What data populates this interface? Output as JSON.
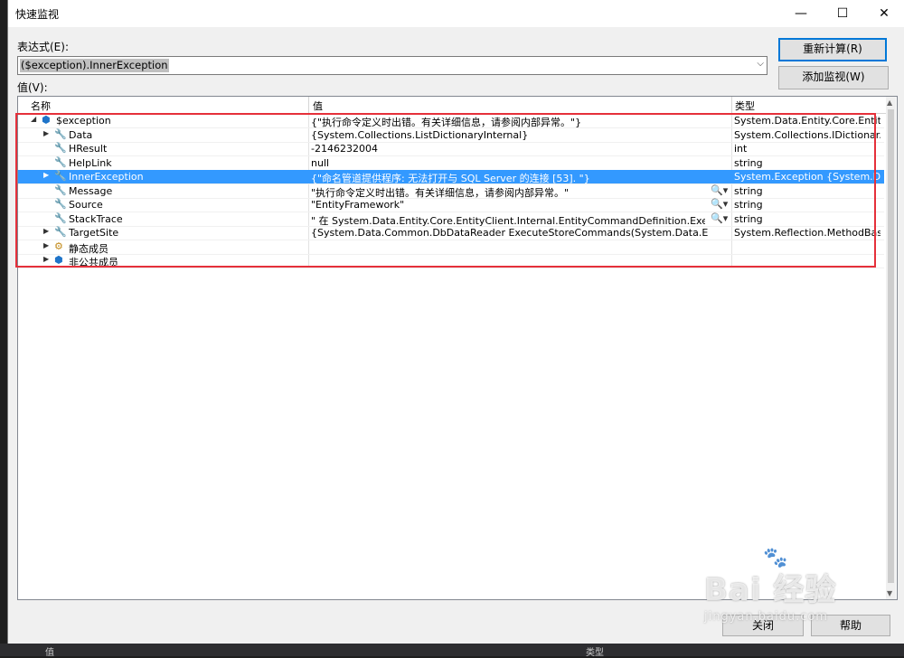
{
  "ide_background": {
    "bottom_labels": [
      "值",
      "类型"
    ]
  },
  "window": {
    "title": "快速监视",
    "controls": {
      "minimize": "—",
      "maximize": "☐",
      "close": "✕"
    }
  },
  "expression": {
    "label": "表达式(E):",
    "value": "($exception).InnerException"
  },
  "buttons": {
    "reevaluate": "重新计算(R)",
    "add_watch": "添加监视(W)",
    "close": "关闭",
    "help": "帮助"
  },
  "value_label": "值(V):",
  "grid": {
    "columns": [
      "名称",
      "值",
      "类型"
    ],
    "rows": [
      {
        "name": "$exception",
        "value": "{\"执行命令定义时出错。有关详细信息，请参阅内部异常。\"}",
        "type": "System.Data.Entity.Core.Entity...",
        "icon": "object-icon",
        "expand": "expanded",
        "indent": 0,
        "selected": false,
        "magnifier": false
      },
      {
        "name": "Data",
        "value": "{System.Collections.ListDictionaryInternal}",
        "type": "System.Collections.IDictionar...",
        "icon": "wrench-icon",
        "expand": "collapsed",
        "indent": 1,
        "selected": false,
        "magnifier": false
      },
      {
        "name": "HResult",
        "value": "-2146232004",
        "type": "int",
        "icon": "wrench-icon",
        "expand": "none",
        "indent": 1,
        "selected": false,
        "magnifier": false
      },
      {
        "name": "HelpLink",
        "value": "null",
        "type": "string",
        "icon": "wrench-icon",
        "expand": "none",
        "indent": 1,
        "selected": false,
        "magnifier": false
      },
      {
        "name": "InnerException",
        "value": "{\"命名管道提供程序: 无法打开与 SQL Server 的连接 [53]. \"}",
        "type": "System.Exception {System.Dat...",
        "icon": "wrench-icon",
        "expand": "collapsed",
        "indent": 1,
        "selected": true,
        "magnifier": false
      },
      {
        "name": "Message",
        "value": "\"执行命令定义时出错。有关详细信息，请参阅内部异常。\"",
        "type": "string",
        "icon": "wrench-icon",
        "expand": "none",
        "indent": 1,
        "selected": false,
        "magnifier": true
      },
      {
        "name": "Source",
        "value": "\"EntityFramework\"",
        "type": "string",
        "icon": "wrench-icon",
        "expand": "none",
        "indent": 1,
        "selected": false,
        "magnifier": true
      },
      {
        "name": "StackTrace",
        "value": "\"   在 System.Data.Entity.Core.EntityClient.Internal.EntityCommandDefinition.ExecuteStore...",
        "type": "string",
        "icon": "wrench-icon",
        "expand": "none",
        "indent": 1,
        "selected": false,
        "magnifier": true
      },
      {
        "name": "TargetSite",
        "value": "{System.Data.Common.DbDataReader ExecuteStoreCommands(System.Data.Entity.Core.EntityC...",
        "type": "System.Reflection.MethodBas...",
        "icon": "wrench-icon",
        "expand": "collapsed",
        "indent": 1,
        "selected": false,
        "magnifier": false
      },
      {
        "name": "静态成员",
        "value": "",
        "type": "",
        "icon": "static-members-icon",
        "expand": "collapsed",
        "indent": 1,
        "selected": false,
        "magnifier": false
      },
      {
        "name": "非公共成员",
        "value": "",
        "type": "",
        "icon": "object-icon",
        "expand": "collapsed",
        "indent": 1,
        "selected": false,
        "magnifier": false
      }
    ]
  },
  "watermark": {
    "brand": "Bai 经验",
    "url": "jingyan.baidu.com"
  },
  "colors": {
    "selection": "#3399ff",
    "highlight_box": "#e5303a",
    "primary_border": "#0078d7"
  }
}
